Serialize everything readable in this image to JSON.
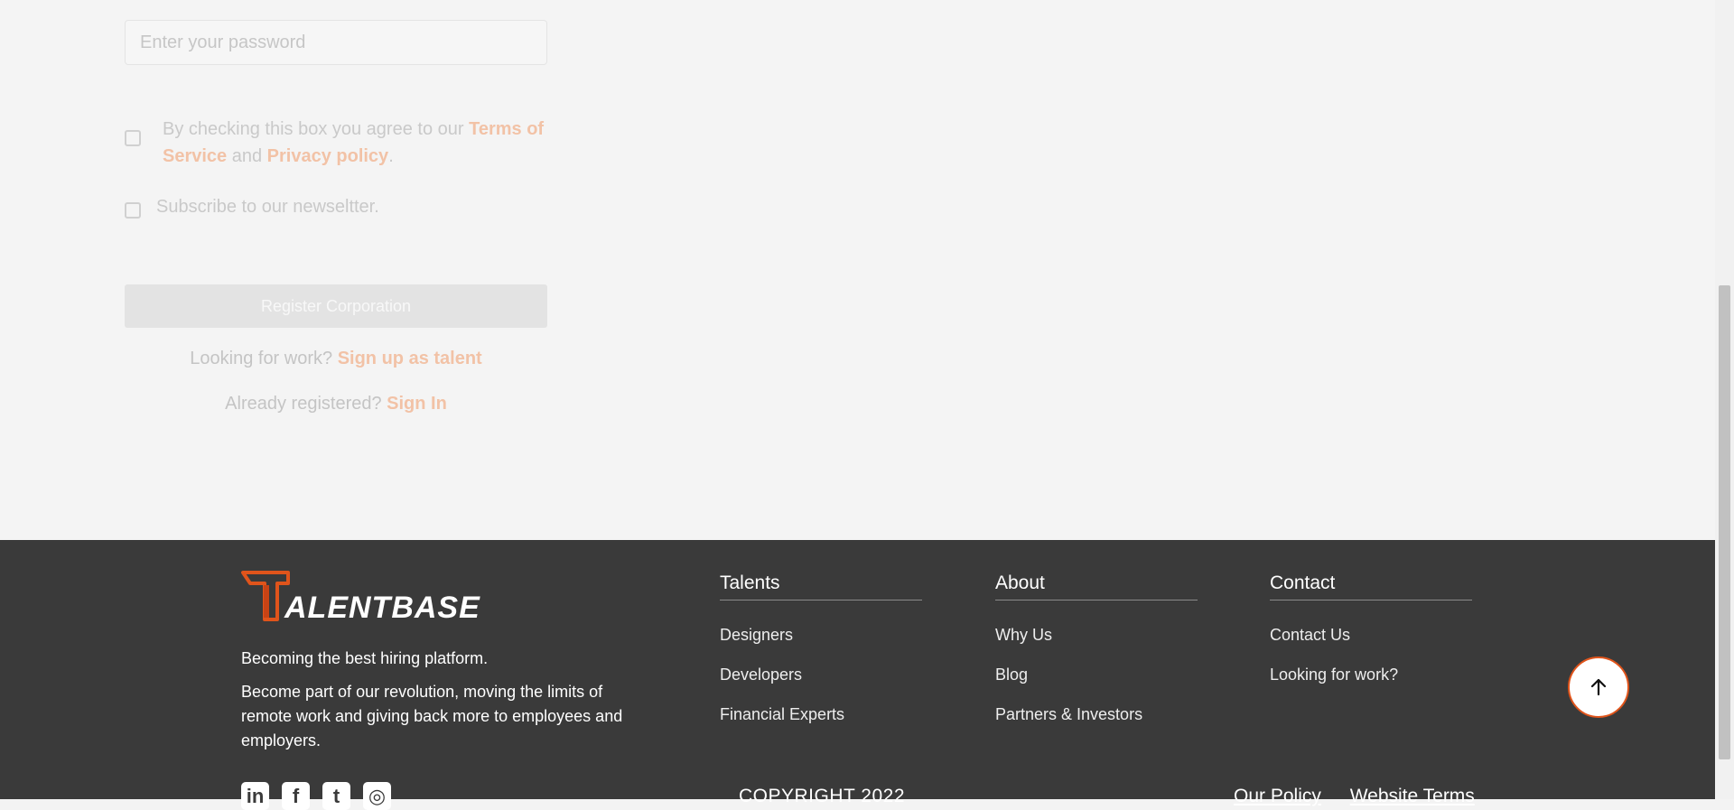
{
  "form": {
    "password_placeholder": "Enter your password",
    "terms_prefix": "By checking this box you agree to our ",
    "terms_link": "Terms of Service",
    "terms_and": " and ",
    "privacy_link": "Privacy policy",
    "terms_suffix": ".",
    "newsletter_label": "Subscribe to our newseltter.",
    "register_button": "Register Corporation",
    "work_prompt": "Looking for work? ",
    "work_link": "Sign up as talent",
    "registered_prompt": "Already registered? ",
    "signin_link": "Sign In"
  },
  "footer": {
    "brand": "TALENTBASE",
    "tagline": "Becoming the best hiring platform.",
    "blurb": "Become part of our revolution, moving the limits of remote work and giving back more to employees and employers.",
    "social_icons": [
      "linkedin-icon",
      "facebook-icon",
      "twitter-icon",
      "instagram-icon"
    ],
    "talents": {
      "title": "Talents",
      "links": [
        "Designers",
        "Developers",
        "Financial Experts"
      ]
    },
    "about": {
      "title": "About",
      "links": [
        "Why Us",
        "Blog",
        "Partners & Investors"
      ]
    },
    "contact": {
      "title": "Contact",
      "links": [
        "Contact Us",
        "Looking for work?"
      ]
    },
    "copyright": "COPYRIGHT 2022",
    "bottom_links": [
      "Our Policy",
      "Website Terms"
    ]
  },
  "colors": {
    "accent": "#e0541b",
    "footer_bg": "#3a3a3a",
    "link_faded": "#f2c2a6"
  }
}
